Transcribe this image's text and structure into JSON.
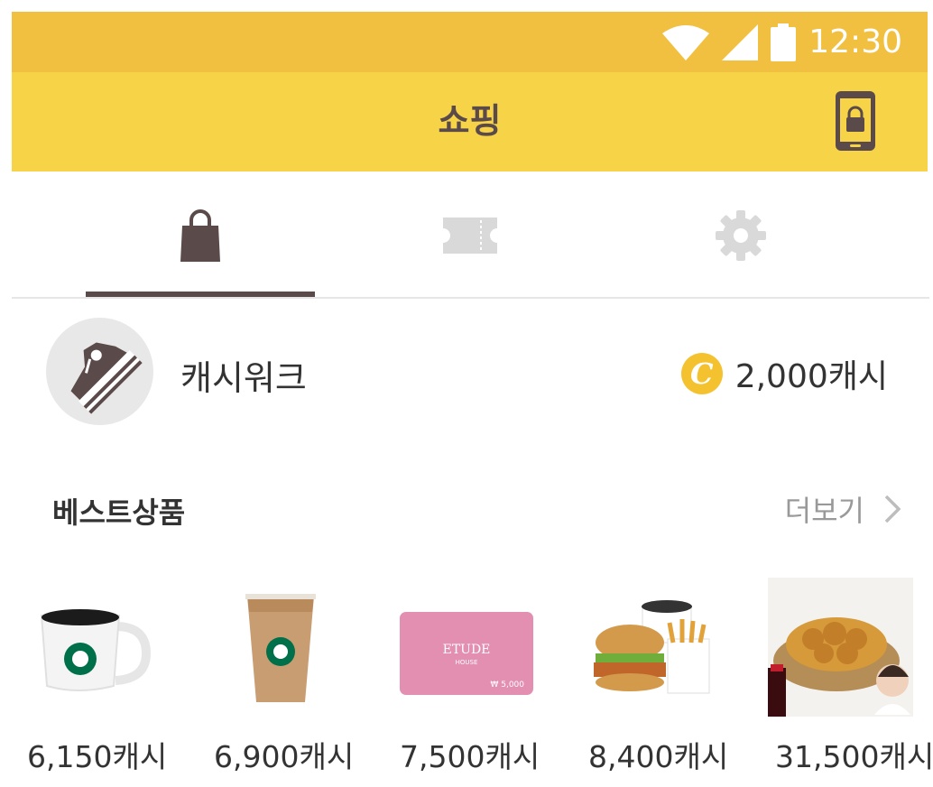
{
  "status_bar": {
    "time": "12:30"
  },
  "app_bar": {
    "title": "쇼핑"
  },
  "tabs": [
    {
      "id": "shop",
      "icon": "shopping-bag-icon",
      "selected": true
    },
    {
      "id": "coupon",
      "icon": "ticket-icon",
      "selected": false
    },
    {
      "id": "settings",
      "icon": "gear-icon",
      "selected": false
    }
  ],
  "profile": {
    "name": "캐시워크",
    "coin_symbol": "C",
    "cash": "2,000캐시"
  },
  "best_section": {
    "title": "베스트상품",
    "more_label": "더보기"
  },
  "products": [
    {
      "name": "coffee-mug",
      "price": "6,150캐시"
    },
    {
      "name": "iced-latte",
      "price": "6,900캐시"
    },
    {
      "name": "etude-gift-card",
      "price": "7,500캐시",
      "card_brand": "ETUDE",
      "card_sub": "HOUSE",
      "card_value": "₩ 5,000"
    },
    {
      "name": "burger-set",
      "price": "8,400캐시"
    },
    {
      "name": "chicken-set",
      "price": "31,500캐시"
    }
  ],
  "colors": {
    "status_bar": "#f2c041",
    "app_bar": "#f7d447",
    "accent_dark": "#5b4a4a",
    "coin": "#f5c22f"
  }
}
